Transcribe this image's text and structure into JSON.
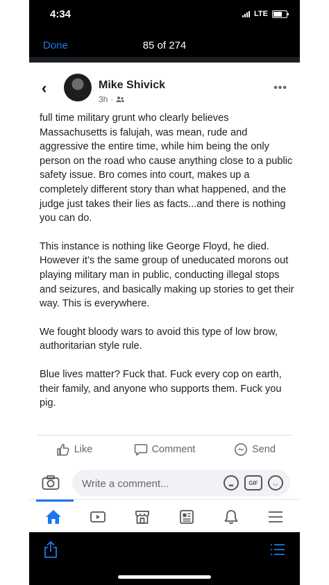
{
  "status_bar": {
    "time": "4:34",
    "network": "LTE"
  },
  "viewer": {
    "done_label": "Done",
    "counter": "85 of 274"
  },
  "post": {
    "author": "Mike Shivick",
    "time": "3h",
    "body": [
      "full time military grunt who clearly believes Massachusetts is falujah, was mean, rude and aggressive the entire time, while him being the only person on the road who cause anything close to a public safety issue. Bro comes into court, makes up a completely different story than what happened, and the judge just takes their lies as facts...and there is nothing you can do.",
      "This instance is nothing like George Floyd, he died. However it’s the same group of uneducated morons out playing military man in public, conducting illegal stops and seizures, and basically making up stories to get their way. This is everywhere.",
      "We fought bloody wars to avoid this type of low brow, authoritarian style rule.",
      "Blue lives matter? Fuck that. Fuck every cop on earth, their family, and anyone who supports them. Fuck you pig."
    ]
  },
  "actions": {
    "like": "Like",
    "comment": "Comment",
    "send": "Send"
  },
  "composer": {
    "placeholder": "Write a comment...",
    "gif_label": "GIF"
  },
  "colors": {
    "accent": "#1877f2",
    "done_blue": "#1a7cf0"
  },
  "icons": [
    "back-chevron-icon",
    "friends-icon",
    "more-icon",
    "like-icon",
    "comment-icon",
    "messenger-icon",
    "camera-icon",
    "sticker-icon",
    "gif-icon",
    "emoji-icon",
    "home-icon",
    "watch-icon",
    "marketplace-icon",
    "news-icon",
    "notifications-icon",
    "menu-icon",
    "share-icon",
    "list-icon"
  ]
}
